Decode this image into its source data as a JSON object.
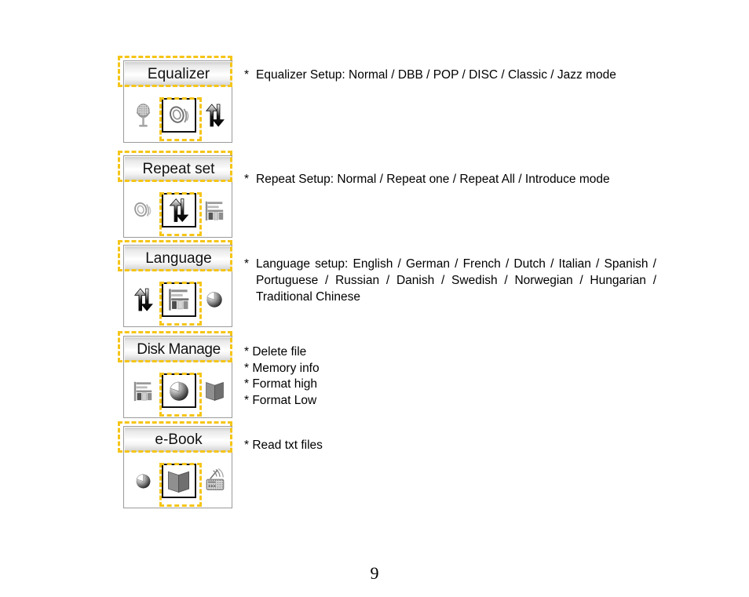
{
  "page": {
    "number": "9"
  },
  "rows": [
    {
      "card": {
        "title": "Equalizer",
        "icons": {
          "left": "microphone-icon",
          "center": "equalizer-waves-icon",
          "right": "up-down-arrows-icon"
        }
      },
      "description": {
        "star": "*",
        "text": "Equalizer Setup: Normal / DBB / POP / DISC / Classic / Jazz mode"
      }
    },
    {
      "card": {
        "title": "Repeat set",
        "icons": {
          "left": "equalizer-waves-icon",
          "center": "up-down-arrows-icon",
          "right": "language-bars-icon"
        }
      },
      "description": {
        "star": "*",
        "text": "Repeat Setup: Normal / Repeat one / Repeat All / Introduce mode"
      }
    },
    {
      "card": {
        "title": "Language",
        "icons": {
          "left": "up-down-arrows-icon",
          "center": "language-bars-icon",
          "right": "pie-chart-icon"
        }
      },
      "description": {
        "star": "*",
        "text": "Language setup: English / German / French / Dutch / Italian / Spanish / Portuguese / Russian / Danish / Swedish / Norwegian / Hungarian / Traditional Chinese"
      }
    },
    {
      "card": {
        "title": "Disk Manage",
        "icons": {
          "left": "language-bars-icon",
          "center": "pie-chart-icon",
          "right": "book-icon"
        }
      },
      "bullets": [
        "* Delete file",
        "* Memory info",
        "* Format high",
        "* Format Low"
      ]
    },
    {
      "card": {
        "title": "e-Book",
        "icons": {
          "left": "pie-chart-icon",
          "center": "book-icon",
          "right": "radio-fm-icon"
        }
      },
      "bullets": [
        "* Read txt files"
      ]
    }
  ],
  "colors": {
    "highlight": "#f5c518",
    "card_border": "#9a9a9a",
    "text": "#000000"
  }
}
